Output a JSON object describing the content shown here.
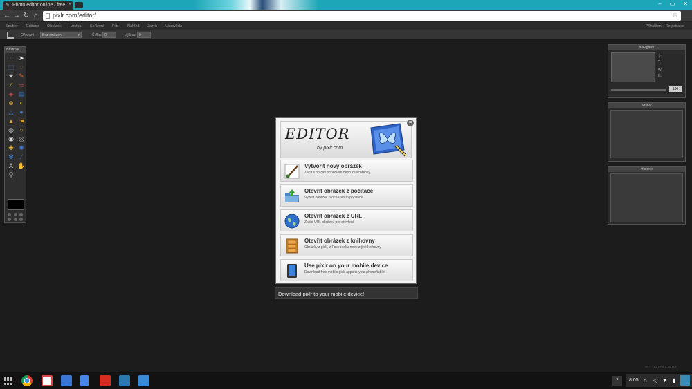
{
  "browser": {
    "tab_title": "Photo editor online / free",
    "tab_close": "×",
    "url": "pixlr.com/editor/",
    "window_controls": [
      "–",
      "▭",
      "✕"
    ]
  },
  "menu": {
    "items": [
      "Soubor",
      "Editace",
      "Obrázek",
      "Vrstva",
      "Seřízení",
      "Filtr",
      "Náhled",
      "Jazyk",
      "Nápověda"
    ],
    "login": "Přihlášení",
    "separator": "|",
    "register": "Registrace"
  },
  "options": {
    "crop_label": "Ořezání:",
    "crop_value": "Bez omezení",
    "width_label": "Šířka:",
    "width_value": "0",
    "height_label": "Výška:",
    "height_value": "0"
  },
  "tools": {
    "title": "Nástroje",
    "icons": [
      "crop-icon",
      "move-icon",
      "marquee-icon",
      "lasso-icon",
      "wand-icon",
      "pencil-icon",
      "brush-icon",
      "eraser-icon",
      "bucket-icon",
      "gradient-icon",
      "clone-icon",
      "colorreplace-icon",
      "drawing-icon",
      "blur-icon",
      "sharpen-icon",
      "smudge-icon",
      "sponge-icon",
      "dodge-icon",
      "burn-icon",
      "redeye-icon",
      "spot-icon",
      "bloat-icon",
      "pinch-icon",
      "picker-icon",
      "type-icon",
      "hand-icon",
      "zoom-icon"
    ]
  },
  "panels": {
    "navigator_title": "Navigátor",
    "navigator_x": "X:",
    "navigator_y": "Y:",
    "navigator_w": "W:",
    "navigator_h": "H:",
    "navigator_zoom": "100",
    "layers_title": "Vrstvy",
    "history_title": "Historie"
  },
  "version": "v8.7 - 81 FPS 8.48 MB",
  "dialog": {
    "logo": "EDITOR",
    "logo_sub": "by pixlr.com",
    "close": "×",
    "options": [
      {
        "title": "Vytvořit nový obrázek",
        "subtitle": "Začít s novým obrázkem nebo ze schránky",
        "icon": "brush-icon"
      },
      {
        "title": "Otevřít obrázek z počítače",
        "subtitle": "Vybrat obrázek procházením počítače",
        "icon": "folder-icon"
      },
      {
        "title": "Otevřít obrázek z URL",
        "subtitle": "Zadat URL obrázku pro otevření",
        "icon": "globe-icon"
      },
      {
        "title": "Otevřít obrázek z knihovny",
        "subtitle": "Obrázky z pixlr, z Facebooku nebo z jiné knihovny",
        "icon": "cabinet-icon"
      },
      {
        "title": "Use pixlr on your mobile device",
        "subtitle": "Download free mobile pixlr apps to your phone/tablet",
        "icon": "tablet-icon"
      }
    ],
    "mobile_bar": "Download pixlr to your mobile device!"
  },
  "taskbar": {
    "apps": [
      "chrome-icon",
      "gmail-icon",
      "google-search-icon",
      "docs-icon",
      "youtube-icon",
      "pixlr-icon",
      "files-icon"
    ],
    "notification_count": "2",
    "time": "8:05"
  }
}
